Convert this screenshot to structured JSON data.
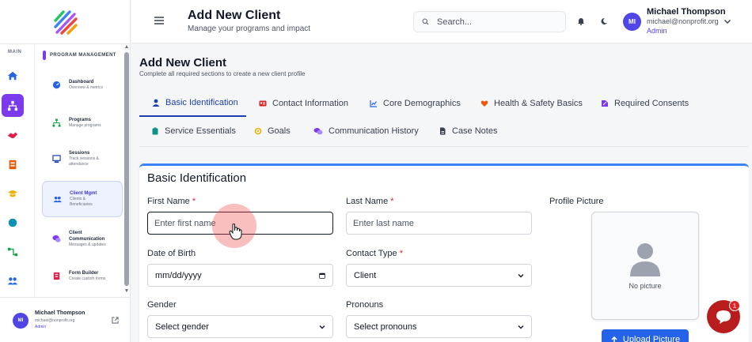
{
  "sidebar": {
    "rail_label": "MAIN",
    "section_title": "PROGRAM MANAGEMENT",
    "rail_icons": [
      {
        "icon": "home-icon",
        "color": "#2563eb"
      },
      {
        "icon": "sitemap-icon",
        "color": "#ffffff",
        "active": true
      },
      {
        "icon": "handshake-icon",
        "color": "#e11d48"
      },
      {
        "icon": "calendar-icon",
        "color": "#ea580c"
      },
      {
        "icon": "graduation-cap-icon",
        "color": "#eab308"
      },
      {
        "icon": "globe-icon",
        "color": "#0891b2"
      },
      {
        "icon": "flow-icon",
        "color": "#16a34a"
      },
      {
        "icon": "users-icon",
        "color": "#2563eb"
      }
    ],
    "items": [
      {
        "title": "Dashboard",
        "subtitle": "Overview & metrics"
      },
      {
        "title": "Programs",
        "subtitle": "Manage programs"
      },
      {
        "title": "Sessions",
        "subtitle": "Track sessions & attendance"
      },
      {
        "title": "Client Mgmt",
        "subtitle": "Clients & Beneficiaries"
      },
      {
        "title": "Client Communication",
        "subtitle": "Messages & updates"
      },
      {
        "title": "Form Builder",
        "subtitle": "Create custom forms"
      }
    ],
    "user": {
      "initials": "MI",
      "name": "Michael Thompson",
      "email": "michael@nonprofit.org",
      "role": "Admin"
    }
  },
  "header": {
    "title": "Add New Client",
    "subtitle": "Manage your programs and impact",
    "search_placeholder": "Search...",
    "user": {
      "initials": "MI",
      "name": "Michael Thompson",
      "email": "michael@nonprofit.org",
      "role": "Admin"
    }
  },
  "page": {
    "title": "Add New Client",
    "subtitle": "Complete all required sections to create a new client profile"
  },
  "tabs": [
    {
      "label": "Basic Identification",
      "icon": "user-icon",
      "active": true
    },
    {
      "label": "Contact Information",
      "icon": "id-card-icon"
    },
    {
      "label": "Core Demographics",
      "icon": "chart-icon"
    },
    {
      "label": "Health & Safety Basics",
      "icon": "heart-icon"
    },
    {
      "label": "Required Consents",
      "icon": "signature-icon"
    },
    {
      "label": "Service Essentials",
      "icon": "clipboard-icon"
    },
    {
      "label": "Goals",
      "icon": "target-icon"
    },
    {
      "label": "Communication History",
      "icon": "comments-icon"
    },
    {
      "label": "Case Notes",
      "icon": "file-icon"
    }
  ],
  "form": {
    "section_title": "Basic Identification",
    "first_name": {
      "label": "First Name",
      "required": "*",
      "placeholder": "Enter first name"
    },
    "last_name": {
      "label": "Last Name",
      "required": "*",
      "placeholder": "Enter last name"
    },
    "dob": {
      "label": "Date of Birth",
      "value": "mm/dd/yyyy"
    },
    "contact_type": {
      "label": "Contact Type",
      "required": "*",
      "value": "Client"
    },
    "gender": {
      "label": "Gender",
      "value": "Select gender"
    },
    "pronouns": {
      "label": "Pronouns",
      "value": "Select pronouns"
    },
    "profile": {
      "label": "Profile Picture",
      "empty_text": "No picture",
      "upload_label": "Upload Picture"
    }
  },
  "chat": {
    "badge": "1"
  },
  "colors": {
    "accent": "#4f46e5",
    "active_tab": "#1e40af",
    "primary_button": "#2563eb",
    "chat": "#b91c1c"
  }
}
